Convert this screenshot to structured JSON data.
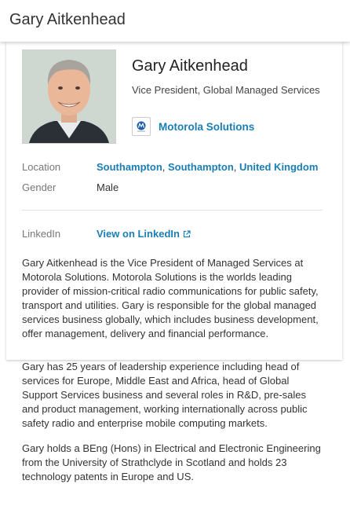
{
  "header": {
    "title": "Gary Aitkenhead"
  },
  "profile": {
    "name": "Gary Aitkenhead",
    "job_title": "Vice President, Global Managed Services",
    "company": {
      "name": "Motorola Solutions",
      "logo_icon": "motorola-logo-icon"
    },
    "photo_alt": "profile-photo"
  },
  "details": {
    "location_label": "Location",
    "location_parts": [
      "Southampton",
      "Southampton",
      "United Kingdom"
    ],
    "location_separator": ", ",
    "gender_label": "Gender",
    "gender_value": "Male",
    "linkedin_label": "LinkedIn",
    "linkedin_link": "View on LinkedIn",
    "linkedin_icon": "external-link-icon"
  },
  "bio": {
    "paragraphs": [
      "Gary Aitkenhead is the Vice President of Managed Services at Motorola Solutions. Motorola Solutions is the worlds leading provider of mission-critical radio communications for public safety, transport and utilities. Gary is responsible for the global managed services business globally, which includes business development, offer management, delivery and financial performance.",
      "Gary has 25 years of leadership experience including head of services for Europe, Middle East and Africa, head of Global Support Services business and several roles in R&D, pre-sales and product management, working internationally across public safety radio and enterprise mobile computing markets.",
      "Gary holds a BEng (Hons) in Electrical and Electronic Engineering from the University of Strathclyde in Scotland and holds 23 technology patents in Europe and US."
    ]
  },
  "colors": {
    "link": "#1a7db5",
    "label": "#777777",
    "text": "#333333"
  }
}
